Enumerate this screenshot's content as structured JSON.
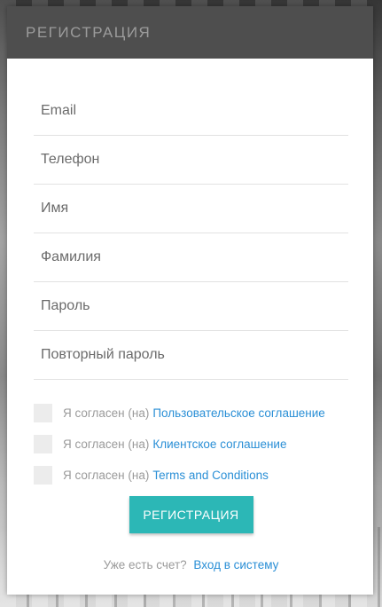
{
  "header": {
    "title": "РЕГИСТРАЦИЯ"
  },
  "form": {
    "fields": [
      {
        "placeholder": "Email"
      },
      {
        "placeholder": "Телефон"
      },
      {
        "placeholder": "Имя"
      },
      {
        "placeholder": "Фамилия"
      },
      {
        "placeholder": "Пароль"
      },
      {
        "placeholder": "Повторный пароль"
      }
    ],
    "agreements": [
      {
        "prefix": "Я согласен (на)",
        "link": "Пользовательское соглашение"
      },
      {
        "prefix": "Я согласен (на)",
        "link": "Клиентское соглашение"
      },
      {
        "prefix": "Я согласен (на)",
        "link": "Terms and Conditions"
      }
    ],
    "submit_label": "РЕГИСТРАЦИЯ"
  },
  "footer": {
    "question": "Уже есть счет?",
    "login_link": "Вход в систему"
  },
  "colors": {
    "header_bg": "#4e4e4e",
    "accent": "#2cb7b6",
    "link": "#2a8fd6"
  }
}
